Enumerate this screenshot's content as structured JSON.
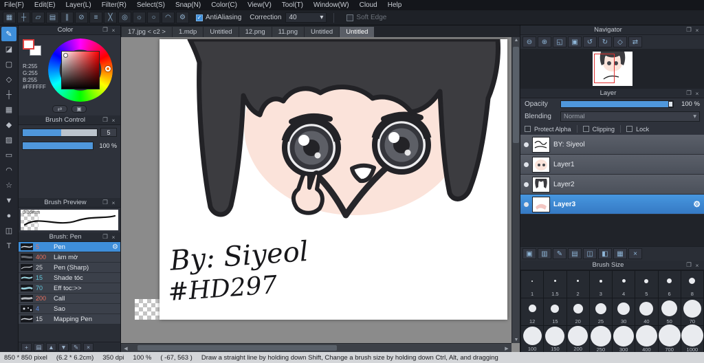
{
  "colors": {
    "accent_blue": "#3e8ed9",
    "selection_red": "#e03030",
    "hair": "#3c3c40",
    "skin": "#fbe3da",
    "foreground": "#FFFFFF"
  },
  "icons": {
    "popout": "❐",
    "close": "×",
    "check": "✓",
    "dropdown": "▾",
    "gear": "⚙",
    "up": "▲",
    "down": "▼",
    "left": "◀",
    "right": "▶",
    "swap": "⇄",
    "reset": "▣"
  },
  "menubar": {
    "items": [
      "File(F)",
      "Edit(E)",
      "Layer(L)",
      "Filter(R)",
      "Select(S)",
      "Snap(N)",
      "Color(C)",
      "View(V)",
      "Tool(T)",
      "Window(W)",
      "Cloud",
      "Help"
    ]
  },
  "toolbar": {
    "icons": [
      {
        "name": "select-icon",
        "glyph": "▦"
      },
      {
        "name": "move-icon",
        "glyph": "┼"
      },
      {
        "name": "transform-icon",
        "glyph": "▱"
      },
      {
        "name": "grid-icon",
        "glyph": "▤"
      },
      {
        "name": "ruler-icon",
        "glyph": "∥"
      },
      {
        "name": "snap-off-icon",
        "glyph": "⊘"
      },
      {
        "name": "snap-parallel-icon",
        "glyph": "≡"
      },
      {
        "name": "snap-cross-icon",
        "glyph": "╳"
      },
      {
        "name": "snap-vanishing-icon",
        "glyph": "◎"
      },
      {
        "name": "snap-radial-icon",
        "glyph": "☼"
      },
      {
        "name": "snap-ellipse-icon",
        "glyph": "○"
      },
      {
        "name": "snap-curve-icon",
        "glyph": "◠"
      },
      {
        "name": "snap-settings-icon",
        "glyph": "⚙"
      }
    ],
    "antialiasing_label": "AntiAliasing",
    "correction_label": "Correction",
    "correction_value": "40",
    "soft_edge_label": "Soft Edge"
  },
  "tools": {
    "items": [
      {
        "name": "brush-tool",
        "glyph": "✎"
      },
      {
        "name": "eraser-tool",
        "glyph": "◪"
      },
      {
        "name": "select-tool",
        "glyph": "▢"
      },
      {
        "name": "polygon-tool",
        "glyph": "◇"
      },
      {
        "name": "move-tool",
        "glyph": "┼"
      },
      {
        "name": "grid-tool",
        "glyph": "▦"
      },
      {
        "name": "fill-tool",
        "glyph": "◆"
      },
      {
        "name": "gradient-tool",
        "glyph": "▨"
      },
      {
        "name": "select-rect-tool",
        "glyph": "▭"
      },
      {
        "name": "lasso-tool",
        "glyph": "◠"
      },
      {
        "name": "magic-wand-tool",
        "glyph": "☆"
      },
      {
        "name": "eyedropper-tool",
        "glyph": "▼"
      },
      {
        "name": "hand-tool",
        "glyph": "●"
      },
      {
        "name": "divide-tool",
        "glyph": "◫"
      },
      {
        "name": "text-tool",
        "glyph": "T"
      }
    ]
  },
  "color_panel": {
    "title": "Color",
    "r": "R:255",
    "g": "G:255",
    "b": "B:255",
    "hex": "#FFFFFF",
    "tools": [
      {
        "name": "swap-colors-icon",
        "glyph": "⇄"
      },
      {
        "name": "reset-colors-icon",
        "glyph": "▣"
      }
    ]
  },
  "brush_control": {
    "title": "Brush Control",
    "size_value": "5",
    "opacity_value": "100 %"
  },
  "brush_preview": {
    "title": "Brush Preview",
    "size_label": "0.36mm"
  },
  "brush_panel": {
    "title": "Brush: Pen",
    "items": [
      {
        "size": "5",
        "name": "Pen",
        "color": "#e8705f"
      },
      {
        "size": "400",
        "name": "Làm mờ",
        "color": "#e8705f"
      },
      {
        "size": "25",
        "name": "Pen (Sharp)",
        "color": "#d8dade"
      },
      {
        "size": "15",
        "name": "Shade tóc",
        "color": "#62c8dc"
      },
      {
        "size": "70",
        "name": "Eff toc:>>",
        "color": "#62c8dc"
      },
      {
        "size": "200",
        "name": "Call",
        "color": "#e8705f"
      },
      {
        "size": "4",
        "name": "Sao",
        "color": "#5a8ae0"
      },
      {
        "size": "15",
        "name": "Mapping Pen",
        "color": "#d8dade"
      }
    ],
    "tools": [
      {
        "name": "add-brush-icon",
        "glyph": "+"
      },
      {
        "name": "brush-folder-icon",
        "glyph": "▤"
      },
      {
        "name": "brush-up-icon",
        "glyph": "▲"
      },
      {
        "name": "brush-down-icon",
        "glyph": "▼"
      },
      {
        "name": "edit-brush-icon",
        "glyph": "✎"
      },
      {
        "name": "delete-brush-icon",
        "glyph": "×"
      }
    ]
  },
  "tabs": {
    "items": [
      {
        "label": "17.jpg < c2 >"
      },
      {
        "label": "1.mdp"
      },
      {
        "label": "Untitled"
      },
      {
        "label": "12.png"
      },
      {
        "label": "11.png"
      },
      {
        "label": "Untitled"
      },
      {
        "label": "Untitled"
      }
    ]
  },
  "canvas": {
    "signature_line1": "By: Siyeol",
    "signature_line2": "#HD297"
  },
  "navigator": {
    "title": "Navigator",
    "tools": [
      {
        "name": "zoom-out-icon",
        "glyph": "⊖"
      },
      {
        "name": "zoom-in-icon",
        "glyph": "⊕"
      },
      {
        "name": "zoom-fit-icon",
        "glyph": "◱"
      },
      {
        "name": "zoom-actual-icon",
        "glyph": "▣"
      },
      {
        "name": "rotate-left-icon",
        "glyph": "↺"
      },
      {
        "name": "rotate-right-icon",
        "glyph": "↻"
      },
      {
        "name": "rotate-reset-icon",
        "glyph": "◇"
      },
      {
        "name": "flip-horizontal-icon",
        "glyph": "⇄"
      }
    ]
  },
  "layer_panel": {
    "title": "Layer",
    "opacity_label": "Opacity",
    "opacity_value": "100 %",
    "blending_label": "Blending",
    "blending_value": "Normal",
    "protect_alpha_label": "Protect Alpha",
    "clipping_label": "Clipping",
    "lock_label": "Lock",
    "layers": [
      {
        "name": "BY: Siyeol"
      },
      {
        "name": "Layer1"
      },
      {
        "name": "Layer2"
      },
      {
        "name": "Layer3"
      }
    ],
    "tools": [
      {
        "name": "new-layer-icon",
        "glyph": "▣"
      },
      {
        "name": "convert-layer-icon",
        "glyph": "▥"
      },
      {
        "name": "draw-transfer-icon",
        "glyph": "✎"
      },
      {
        "name": "new-folder-icon",
        "glyph": "▤"
      },
      {
        "name": "duplicate-layer-icon",
        "glyph": "◫"
      },
      {
        "name": "mask-layer-icon",
        "glyph": "◧"
      },
      {
        "name": "merge-layer-icon",
        "glyph": "▦"
      },
      {
        "name": "delete-layer-icon",
        "glyph": "×"
      }
    ]
  },
  "brush_size_panel": {
    "title": "Brush Size",
    "sizes": [
      "1",
      "1.5",
      "2",
      "3",
      "4",
      "5",
      "6",
      "8",
      "12",
      "15",
      "20",
      "25",
      "30",
      "40",
      "50",
      "70",
      "100",
      "150",
      "200",
      "250",
      "300",
      "400",
      "700",
      "1000"
    ]
  },
  "statusbar": {
    "size": "850 * 850 pixel",
    "dimensions": "(6.2 * 6.2cm)",
    "dpi": "350 dpi",
    "zoom": "100 %",
    "coords": "( -67, 563 )",
    "hint": "Draw a straight line by holding down Shift, Change a brush size by holding down Ctrl, Alt, and dragging"
  }
}
